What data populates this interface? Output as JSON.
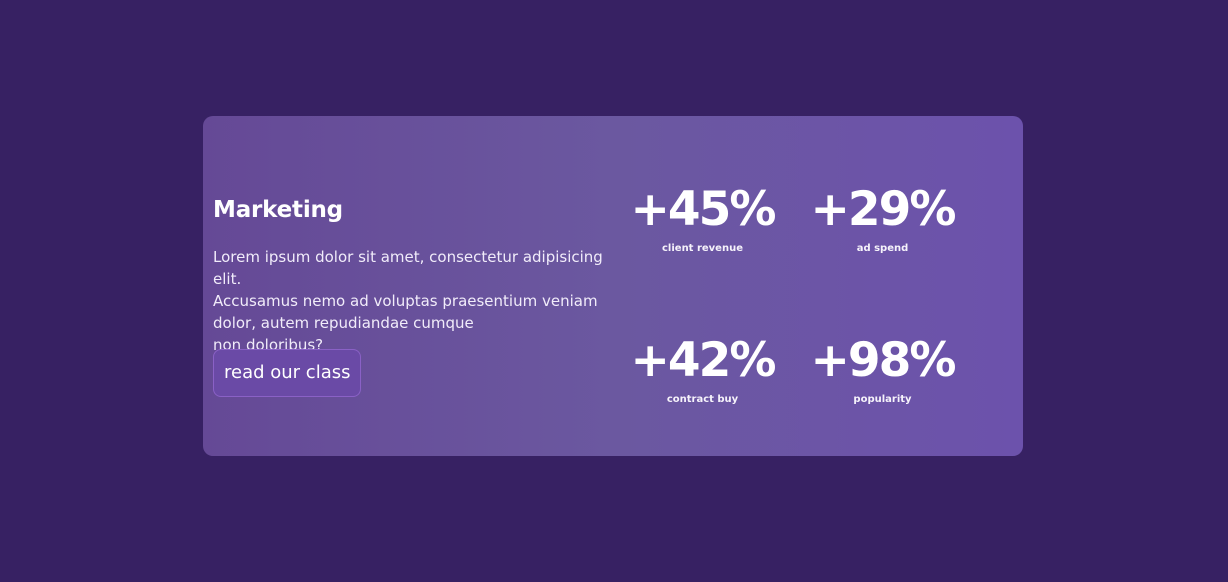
{
  "card": {
    "title": "Marketing",
    "description": "Lorem ipsum dolor sit amet, consectetur adipisicing elit.\nAccusamus nemo ad voluptas praesentium veniam\ndolor, autem repudiandae cumque\nnon doloribus?",
    "cta_label": "read our class"
  },
  "stats": [
    {
      "value": "+45%",
      "label": "client revenue"
    },
    {
      "value": "+29%",
      "label": "ad spend"
    },
    {
      "value": "+42%",
      "label": "contract buy"
    },
    {
      "value": "+98%",
      "label": "popularity"
    }
  ],
  "colors": {
    "page_background": "#372163",
    "card_gradient_start": "#654996",
    "card_gradient_end": "#6c52ac",
    "button_border": "#8a61c6",
    "text": "#ffffff"
  }
}
